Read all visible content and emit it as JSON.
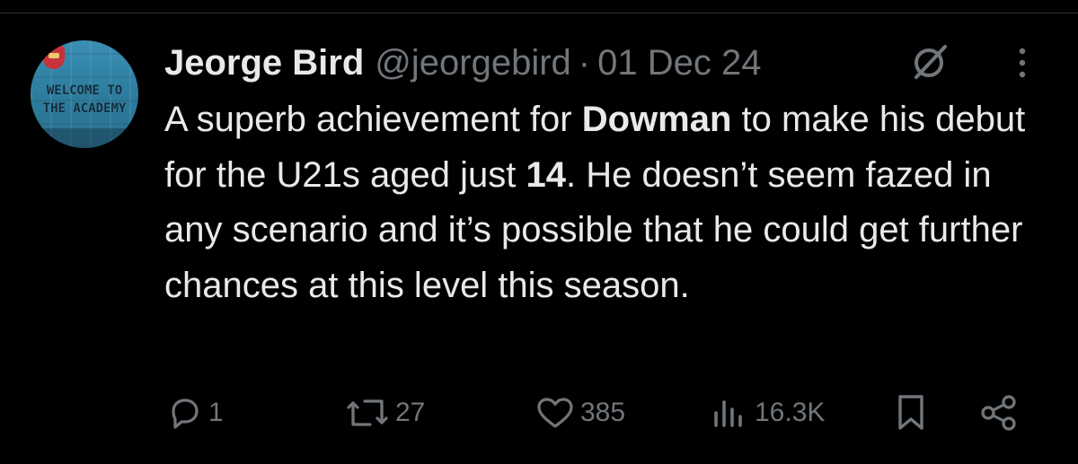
{
  "author": {
    "display_name": "Jeorge Bird",
    "handle": "@jeorgebird",
    "separator": "·",
    "date": "01 Dec 24",
    "avatar_text_line1": "WELCOME TO",
    "avatar_text_line2": "THE ACADEMY"
  },
  "tweet": {
    "segments": [
      {
        "text": "A superb achievement for ",
        "bold": false
      },
      {
        "text": "Dowman",
        "bold": true
      },
      {
        "text": " to make his debut for the U21s aged just ",
        "bold": false
      },
      {
        "text": "14",
        "bold": true
      },
      {
        "text": ". He doesn’t seem fazed in any scenario and it’s possible that he could get further chances at this level this season.",
        "bold": false
      }
    ]
  },
  "actions": {
    "replies": "1",
    "reposts": "27",
    "likes": "385",
    "views": "16.3K"
  },
  "icons": {
    "reply": "reply-icon",
    "repost": "repost-icon",
    "like": "heart-icon",
    "views": "views-icon",
    "bookmark": "bookmark-icon",
    "share": "share-icon",
    "grok": "grok-icon",
    "more": "more-icon"
  },
  "colors": {
    "background": "#000000",
    "text": "#e7e9ea",
    "muted": "#71767b"
  }
}
